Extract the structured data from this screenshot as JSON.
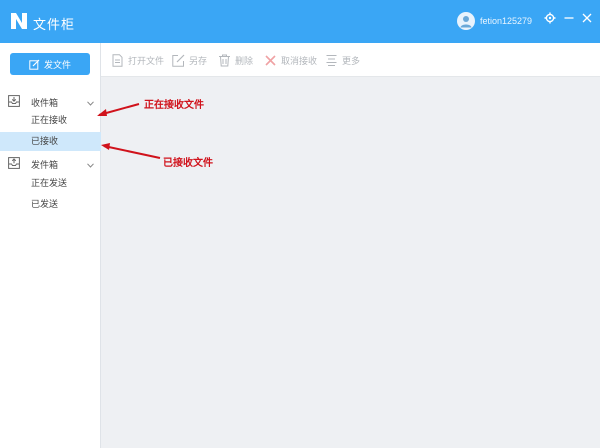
{
  "app": {
    "title": "文件柜"
  },
  "user": {
    "name": "fetion125279"
  },
  "sidebar": {
    "compose_label": "发文件",
    "groups": [
      {
        "label": "收件箱",
        "items": [
          "正在接收",
          "已接收"
        ]
      },
      {
        "label": "发件箱",
        "items": [
          "正在发送",
          "已发送"
        ]
      }
    ]
  },
  "toolbar": {
    "items": [
      "打开文件",
      "另存",
      "删除",
      "取消接收",
      "更多"
    ]
  },
  "annotations": {
    "receiving": "正在接收文件",
    "received": "已接收文件"
  },
  "colors": {
    "accent": "#3aa6f5",
    "annotation": "#d0121b",
    "active_row": "#cfe8fb"
  }
}
